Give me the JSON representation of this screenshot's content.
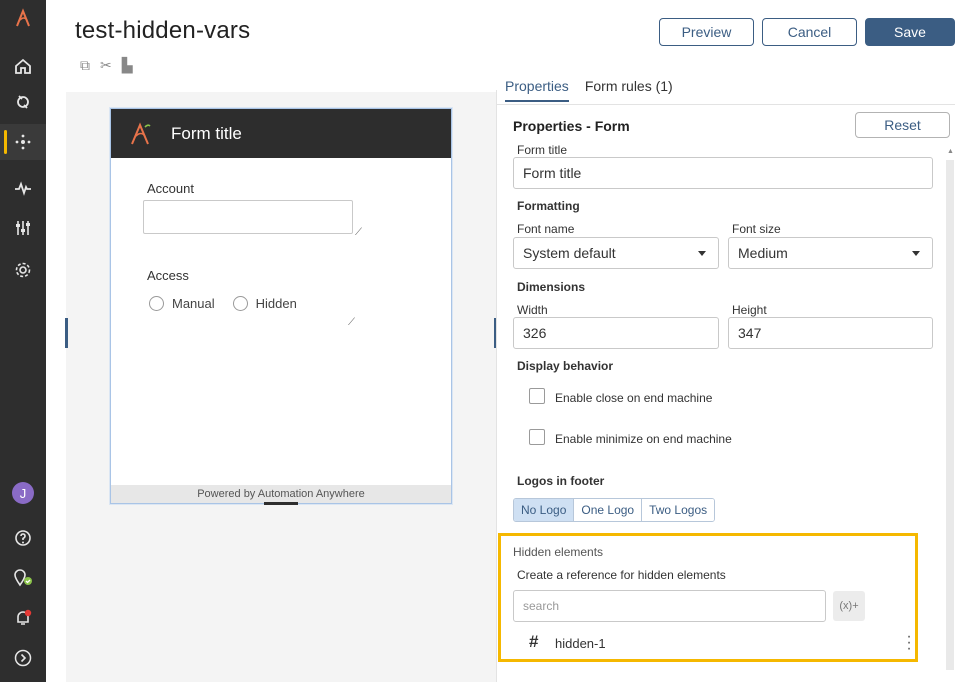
{
  "header": {
    "title": "test-hidden-vars",
    "preview_label": "Preview",
    "cancel_label": "Cancel",
    "save_label": "Save"
  },
  "nav": {
    "user_initial": "J"
  },
  "form_preview": {
    "title": "Form title",
    "account_label": "Account",
    "access_label": "Access",
    "radio_options": [
      "Manual",
      "Hidden"
    ],
    "footer_text": "Powered by Automation Anywhere"
  },
  "tabs": [
    {
      "label": "Properties",
      "active": true
    },
    {
      "label": "Form rules (1)",
      "active": false
    }
  ],
  "properties": {
    "heading": "Properties - Form",
    "reset_label": "Reset",
    "form_title_label": "Form title",
    "form_title_value": "Form title",
    "formatting_heading": "Formatting",
    "font_name_label": "Font name",
    "font_name_value": "System default",
    "font_size_label": "Font size",
    "font_size_value": "Medium",
    "dimensions_heading": "Dimensions",
    "width_label": "Width",
    "width_value": "326",
    "height_label": "Height",
    "height_value": "347",
    "display_behavior_heading": "Display behavior",
    "close_on_end_label": "Enable close on end machine",
    "minimize_on_end_label": "Enable minimize on end machine",
    "logos_heading": "Logos in footer",
    "logo_options": [
      "No Logo",
      "One Logo",
      "Two Logos"
    ],
    "logo_selected": "No Logo"
  },
  "hidden_elements": {
    "heading": "Hidden elements",
    "subheading": "Create a reference for hidden elements",
    "search_placeholder": "search",
    "var_button": "(x)+",
    "items": [
      {
        "name": "hidden-1"
      }
    ]
  },
  "colors": {
    "accent": "#3b5d83",
    "highlight": "#f5b800",
    "nav_bg": "#2e2e2e"
  }
}
